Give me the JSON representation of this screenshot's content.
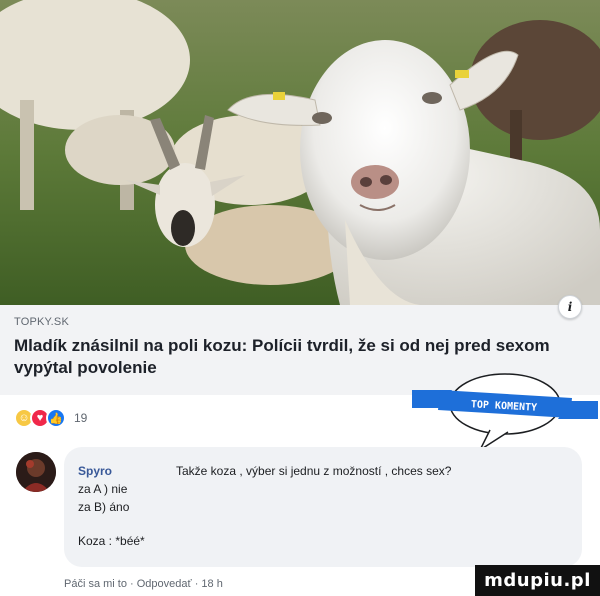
{
  "post": {
    "source": "TOPKY.SK",
    "headline": "Mladík znásilnil na poli kozu: Polícii tvrdil, že si od nej pred sexom vypýtal povolenie",
    "info_icon": "i"
  },
  "reactions": {
    "icons": [
      "haha-reaction-icon",
      "love-reaction-icon",
      "like-reaction-icon"
    ],
    "count": "19"
  },
  "badge": {
    "label": "TOP KOMENTY",
    "color": "#1e6fd9"
  },
  "comment": {
    "author": "Spyro",
    "text": "Takže koza , výber si jednu z možností , chces sex?",
    "lines": [
      "za A ) nie",
      "za B) áno",
      "Koza : *béé*"
    ],
    "actions": {
      "like": "Páči sa mi to",
      "reply": "Odpovedať",
      "time": "18 h"
    }
  },
  "watermark": "mdupiu.pl",
  "colors": {
    "link_box": "#f2f3f5",
    "name": "#385898",
    "bubble": "#f0f2f5"
  }
}
